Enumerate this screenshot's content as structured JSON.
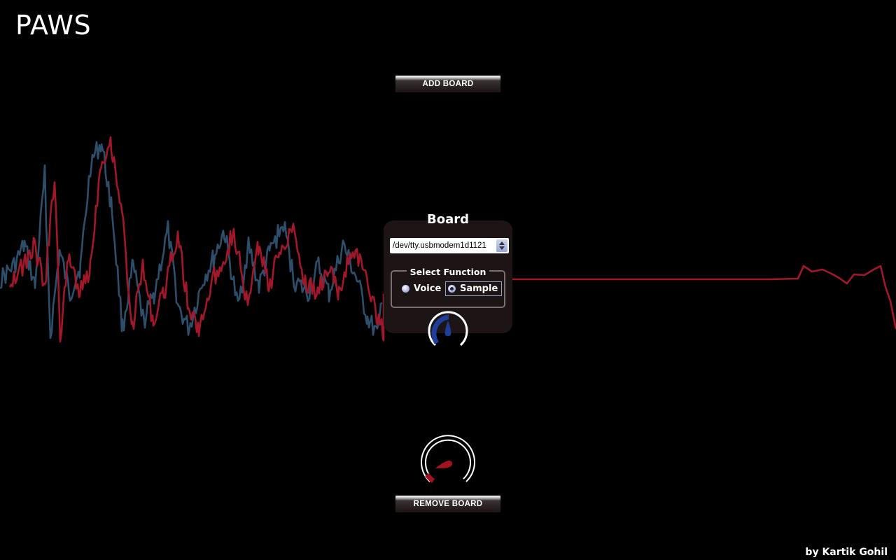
{
  "app": {
    "title": "PAWS",
    "credit": "by Kartik Gohil"
  },
  "toolbar": {
    "add_board_label": "ADD BOARD",
    "remove_board_label": "REMOVE BOARD"
  },
  "board": {
    "title": "Board",
    "port": {
      "selected": "/dev/tty.usbmodem1d1121"
    },
    "function_group": {
      "legend": "Select Function",
      "options": [
        {
          "label": "Voice",
          "checked": false
        },
        {
          "label": "Sample",
          "checked": true
        }
      ]
    },
    "knob_accent": "#1f3d9a"
  },
  "main_knob": {
    "accent": "#a3131f"
  },
  "waveforms": {
    "series": [
      {
        "color": "#2e4f6c"
      },
      {
        "color": "#a3172b"
      }
    ]
  },
  "colors": {
    "background": "#000000",
    "panel": "#1d1515"
  },
  "icons": [
    "radio-icon",
    "select-arrows-icon",
    "knob-icon"
  ]
}
